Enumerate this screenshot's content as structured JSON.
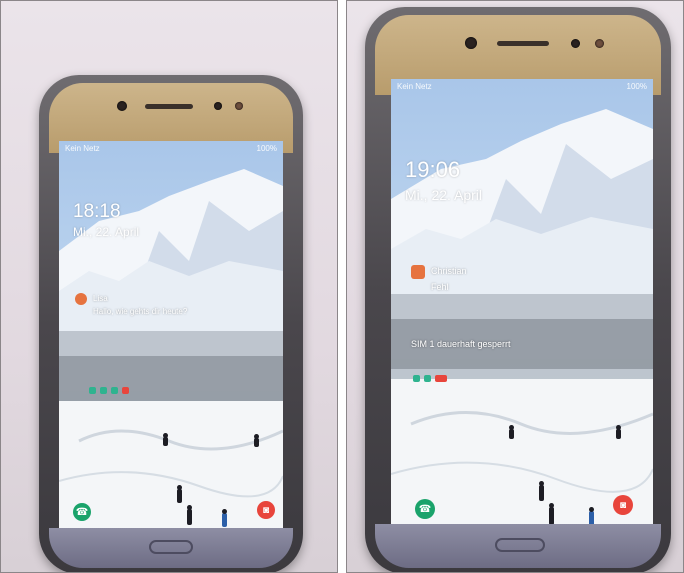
{
  "photos": [
    {
      "id": "left",
      "screen": {
        "carrier": "Kein Netz",
        "battery": "100%",
        "clock": "18:18",
        "date": "Mi., 22. April",
        "notification_title": "Lisa",
        "notification_text": "Hallo, wie gehts dir heute?",
        "shortcut_left": "phone",
        "shortcut_right": "camera"
      }
    },
    {
      "id": "right",
      "screen": {
        "carrier": "Kein Netz",
        "battery": "100%",
        "clock": "19:06",
        "date": "Mi., 22. April",
        "notification_title": "Christian",
        "notification_text": "Fehl",
        "sim_message": "SIM 1 dauerhaft gesperrt",
        "shortcut_left": "phone",
        "shortcut_right": "camera"
      }
    }
  ],
  "colors": {
    "gold_bezel": "#c3a878",
    "phone_shortcut": "#1aa36b",
    "camera_shortcut": "#e8453c",
    "notif_badge": "#e6733f"
  }
}
